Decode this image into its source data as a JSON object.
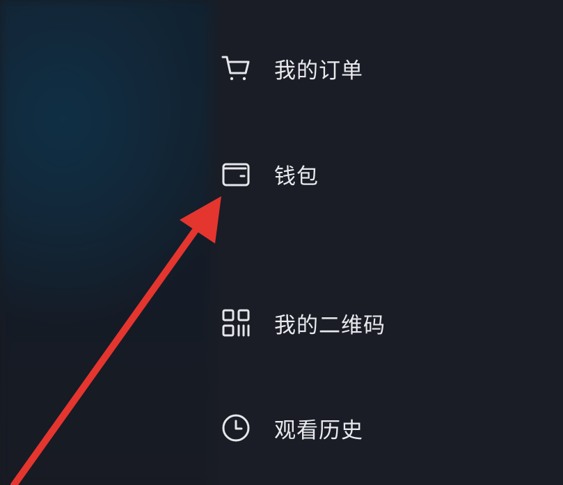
{
  "menu": {
    "items": [
      {
        "label": "我的订单",
        "icon": "cart-icon"
      },
      {
        "label": "钱包",
        "icon": "wallet-icon"
      },
      {
        "label": "我的二维码",
        "icon": "qrcode-icon"
      },
      {
        "label": "观看历史",
        "icon": "clock-icon"
      }
    ]
  },
  "annotation": {
    "arrow_color": "#e5352f",
    "points_to": "钱包"
  },
  "colors": {
    "background": "#1a1d25",
    "text": "#e9eaee",
    "icon": "#e6e7eb"
  }
}
